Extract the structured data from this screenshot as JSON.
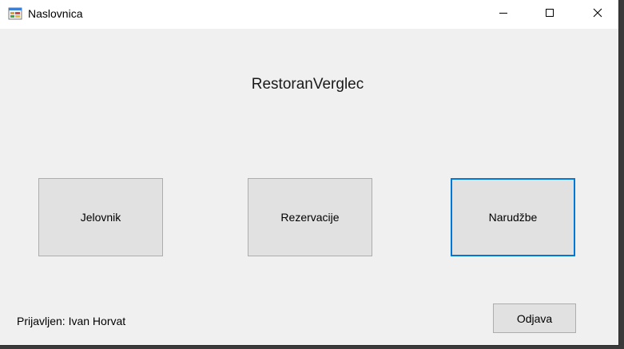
{
  "window": {
    "title": "Naslovnica",
    "icon": "winforms-app-icon"
  },
  "titlebar_buttons": {
    "minimize_icon": "minimize-icon",
    "maximize_icon": "maximize-icon",
    "close_icon": "close-icon"
  },
  "main": {
    "heading": "RestoranVerglec",
    "buttons": [
      {
        "label": "Jelovnik"
      },
      {
        "label": "Rezervacije"
      },
      {
        "label": "Narudžbe",
        "focused": true
      }
    ]
  },
  "footer": {
    "status": "Prijavljen: Ivan Horvat",
    "logout_label": "Odjava"
  },
  "colors": {
    "window_bg": "#f0f0f0",
    "titlebar_bg": "#ffffff",
    "button_bg": "#e1e1e1",
    "focus_accent": "#0078d7"
  }
}
